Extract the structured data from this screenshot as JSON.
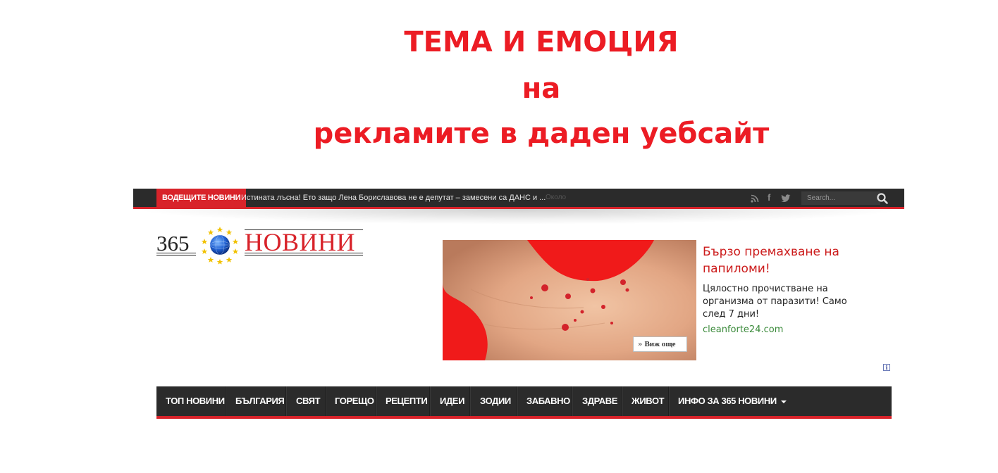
{
  "slide": {
    "title_line1": "ТЕМА И ЕМОЦИЯ",
    "title_line2": "на",
    "title_line3": "рекламите в даден уебсайт"
  },
  "topbar": {
    "breaking_label": "ВОДЕЩИТЕ НОВИНИ",
    "breaking_text": "Истината лъсна! Ето защо Лена Бориславова не е депутат – замесени са ДАНС и ...",
    "breaking_time": "Около",
    "social_icons": [
      "rss-icon",
      "facebook-icon",
      "twitter-icon"
    ],
    "search_placeholder": "Search..."
  },
  "logo": {
    "number": "365",
    "word": "НОВИНИ",
    "globe_icon": "globe-with-stars-icon"
  },
  "ad": {
    "headline": "Бързо премахване на папиломи!",
    "description": "Цялостно прочистване на организма от паразити! Само след 7 дни!",
    "domain": "cleanforte24.com",
    "more_button": "Виж още",
    "info_icon": "i",
    "colors": {
      "headline": "#cc1b1b",
      "domain": "#3a8a3a",
      "background": "#f01a1a"
    }
  },
  "nav": {
    "items": [
      "ТОП НОВИНИ",
      "БЪЛГАРИЯ",
      "СВЯТ",
      "ГОРЕЩО",
      "РЕЦЕПТИ",
      "ИДЕИ",
      "ЗОДИИ",
      "ЗАБАВНО",
      "ЗДРАВЕ",
      "ЖИВОТ",
      "ИНФО ЗА 365 НОВИНИ"
    ],
    "colors": {
      "bar": "#2b2b2b",
      "accent": "#d8232a"
    }
  }
}
